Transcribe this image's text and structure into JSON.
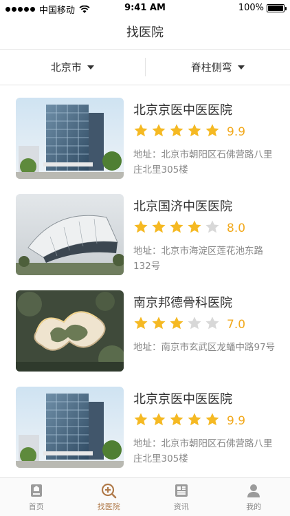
{
  "status_bar": {
    "carrier": "中国移动",
    "time": "9:41 AM",
    "battery": "100%"
  },
  "nav": {
    "title": "找医院"
  },
  "filters": [
    {
      "label": "北京市"
    },
    {
      "label": "脊柱侧弯"
    }
  ],
  "hospitals": [
    {
      "name": "北京京医中医医院",
      "stars": 5,
      "score": "9.9",
      "address": "地址：北京市朝阳区石佛营路八里庄北里305楼",
      "image": "office-building"
    },
    {
      "name": "北京国济中医医院",
      "stars": 4,
      "score": "8.0",
      "address": "地址：北京市海淀区莲花池东路132号",
      "image": "modern-curved-building"
    },
    {
      "name": "南京邦德骨科医院",
      "stars": 3,
      "score": "7.0",
      "address": "地址：南京市玄武区龙蟠中路97号",
      "image": "ring-shaped-building"
    },
    {
      "name": "北京京医中医医院",
      "stars": 5,
      "score": "9.9",
      "address": "地址：北京市朝阳区石佛营路八里庄北里305楼",
      "image": "office-building"
    }
  ],
  "tabs": [
    {
      "label": "首页",
      "icon": "home-icon"
    },
    {
      "label": "找医院",
      "icon": "find-hospital-icon",
      "active": true
    },
    {
      "label": "资讯",
      "icon": "news-icon"
    },
    {
      "label": "我的",
      "icon": "profile-icon"
    }
  ],
  "colors": {
    "accent": "#b07a4a",
    "star_on": "#f5b923",
    "star_off": "#d8d8d8",
    "score": "#f2a91c"
  }
}
